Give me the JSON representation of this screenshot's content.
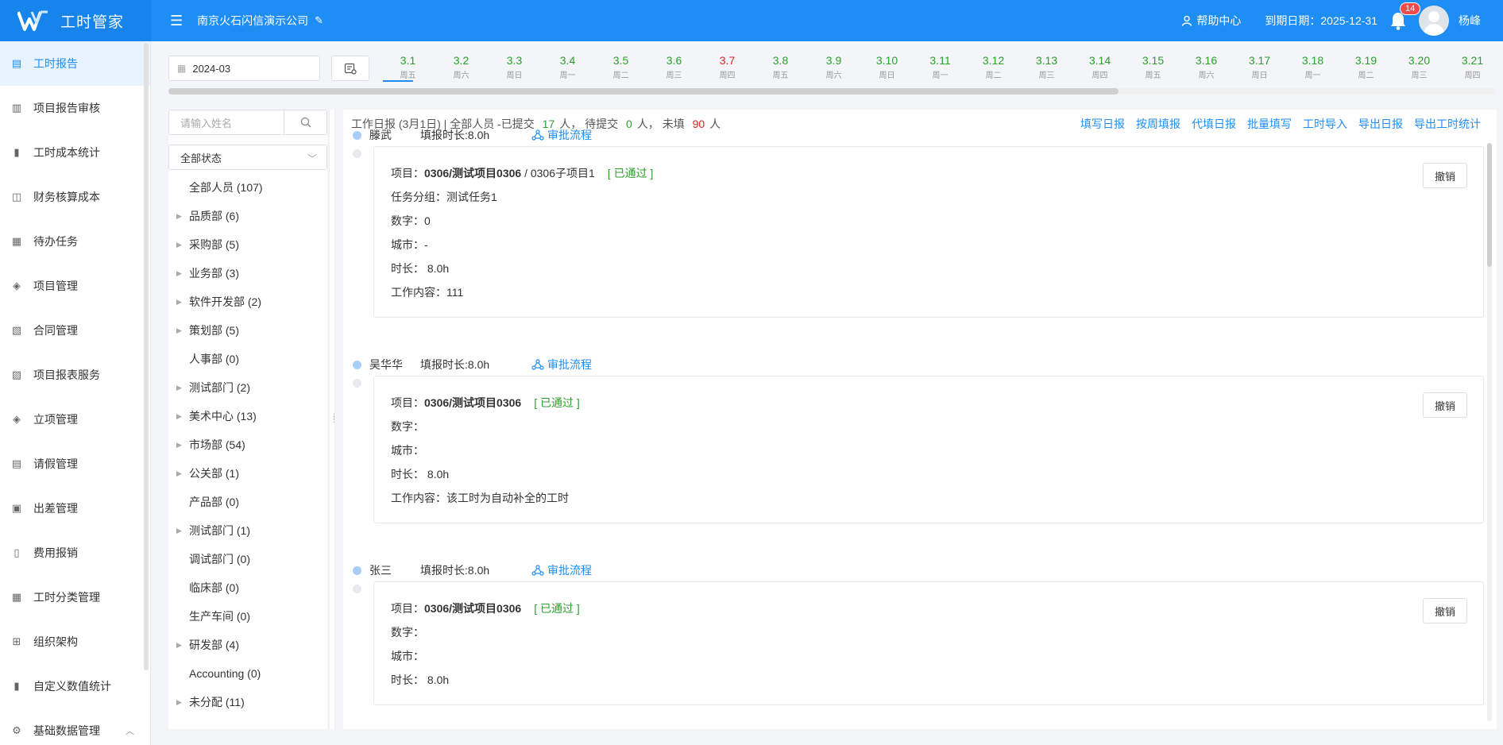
{
  "header": {
    "logo_text": "工时管家",
    "company": "南京火石闪信演示公司",
    "help_label": "帮助中心",
    "expire_label": "到期日期：2025-12-31",
    "notif_count": "14",
    "username": "杨峰",
    "brand_color": "#1e8ef5"
  },
  "sidebar": {
    "items": [
      {
        "label": "工时报告",
        "icon": "report-icon"
      },
      {
        "label": "项目报告审核",
        "icon": "review-icon"
      },
      {
        "label": "工时成本统计",
        "icon": "bar-chart-icon"
      },
      {
        "label": "财务核算成本",
        "icon": "finance-icon"
      },
      {
        "label": "待办任务",
        "icon": "todo-icon"
      },
      {
        "label": "项目管理",
        "icon": "layers-icon"
      },
      {
        "label": "合同管理",
        "icon": "contract-icon"
      },
      {
        "label": "项目报表服务",
        "icon": "chart-doc-icon"
      },
      {
        "label": "立项管理",
        "icon": "layers-icon"
      },
      {
        "label": "请假管理",
        "icon": "leave-icon"
      },
      {
        "label": "出差管理",
        "icon": "trip-icon"
      },
      {
        "label": "费用报销",
        "icon": "expense-icon"
      },
      {
        "label": "工时分类管理",
        "icon": "category-icon"
      },
      {
        "label": "组织架构",
        "icon": "org-icon"
      },
      {
        "label": "自定义数值统计",
        "icon": "bar-chart-icon"
      },
      {
        "label": "基础数据管理",
        "icon": "settings-icon"
      }
    ]
  },
  "datebar": {
    "month_value": "2024-03",
    "days": [
      {
        "d": "3.1",
        "w": "周五"
      },
      {
        "d": "3.2",
        "w": "周六"
      },
      {
        "d": "3.3",
        "w": "周日"
      },
      {
        "d": "3.4",
        "w": "周一"
      },
      {
        "d": "3.5",
        "w": "周二"
      },
      {
        "d": "3.6",
        "w": "周三"
      },
      {
        "d": "3.7",
        "w": "周四"
      },
      {
        "d": "3.8",
        "w": "周五"
      },
      {
        "d": "3.9",
        "w": "周六"
      },
      {
        "d": "3.10",
        "w": "周日"
      },
      {
        "d": "3.11",
        "w": "周一"
      },
      {
        "d": "3.12",
        "w": "周二"
      },
      {
        "d": "3.13",
        "w": "周三"
      },
      {
        "d": "3.14",
        "w": "周四"
      },
      {
        "d": "3.15",
        "w": "周五"
      },
      {
        "d": "3.16",
        "w": "周六"
      },
      {
        "d": "3.17",
        "w": "周日"
      },
      {
        "d": "3.18",
        "w": "周一"
      },
      {
        "d": "3.19",
        "w": "周二"
      },
      {
        "d": "3.20",
        "w": "周三"
      },
      {
        "d": "3.21",
        "w": "周四"
      }
    ]
  },
  "dept": {
    "search_placeholder": "请输入姓名",
    "status_value": "全部状态",
    "tree": [
      {
        "label": "全部人员 (107)",
        "expandable": false
      },
      {
        "label": "品质部 (6)",
        "expandable": true
      },
      {
        "label": "采购部 (5)",
        "expandable": true
      },
      {
        "label": "业务部 (3)",
        "expandable": true
      },
      {
        "label": "软件开发部 (2)",
        "expandable": true
      },
      {
        "label": "策划部 (5)",
        "expandable": true
      },
      {
        "label": "人事部 (0)",
        "expandable": false
      },
      {
        "label": "测试部门 (2)",
        "expandable": true
      },
      {
        "label": "美术中心 (13)",
        "expandable": true
      },
      {
        "label": "市场部 (54)",
        "expandable": true
      },
      {
        "label": "公关部 (1)",
        "expandable": true
      },
      {
        "label": "产品部 (0)",
        "expandable": false
      },
      {
        "label": "测试部门 (1)",
        "expandable": true
      },
      {
        "label": "调试部门 (0)",
        "expandable": false
      },
      {
        "label": "临床部 (0)",
        "expandable": false
      },
      {
        "label": "生产车间 (0)",
        "expandable": false
      },
      {
        "label": "研发部 (4)",
        "expandable": true
      },
      {
        "label": "Accounting (0)",
        "expandable": false
      },
      {
        "label": "未分配 (11)",
        "expandable": true
      }
    ]
  },
  "main": {
    "summary_prefix": "工作日报 (3月1日) | 全部人员 -已提交",
    "submitted": "17",
    "unit1": "人，  待提交",
    "pending": "0",
    "unit2": "人，  未填",
    "unfilled": "90",
    "unit3": "人",
    "actions": [
      "填写日报",
      "按周填报",
      "代填日报",
      "批量填写",
      "工时导入",
      "导出日报",
      "导出工时统计"
    ],
    "entries": [
      {
        "name": "滕武",
        "hours": "填报时长:8.0h",
        "flow": "审批流程",
        "project_label": "项目：",
        "project": "0306/测试项目0306",
        "subproject": " / 0306子项目1",
        "status": "[ 已通过 ]",
        "lines": [
          "任务分组：测试任务1",
          "数字：0",
          "城市：-",
          "时长： 8.0h",
          "工作内容：111"
        ],
        "revoke": "撤销"
      },
      {
        "name": "吴华华",
        "hours": "填报时长:8.0h",
        "flow": "审批流程",
        "project_label": "项目：",
        "project": "0306/测试项目0306",
        "subproject": "",
        "status": "[ 已通过 ]",
        "lines": [
          "数字：",
          "城市：",
          "时长： 8.0h",
          "工作内容：该工时为自动补全的工时"
        ],
        "revoke": "撤销"
      },
      {
        "name": "张三",
        "hours": "填报时长:8.0h",
        "flow": "审批流程",
        "project_label": "项目：",
        "project": "0306/测试项目0306",
        "subproject": "",
        "status": "[ 已通过 ]",
        "lines": [
          "数字：",
          "城市：",
          "时长： 8.0h"
        ],
        "revoke": "撤销"
      }
    ]
  }
}
